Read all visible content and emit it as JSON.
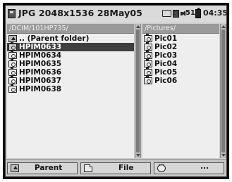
{
  "status": {
    "title": "JPG 2048x1536 28May05",
    "volume": "51",
    "time": "04:35",
    "icons": [
      "file-icon",
      "folder-icon",
      "hard-drive-icon",
      "speaker-icon",
      "battery-icon"
    ]
  },
  "left_pane": {
    "path": "/DCIM/101HP735/",
    "items": [
      {
        "label": ".. (Parent folder)",
        "icon": "parent-folder-icon"
      },
      {
        "label": "HPIM0633",
        "icon": "photo-icon",
        "selected": true
      },
      {
        "label": "HPIM0634",
        "icon": "photo-icon"
      },
      {
        "label": "HPIM0635",
        "icon": "photo-icon"
      },
      {
        "label": "HPIM0636",
        "icon": "photo-icon"
      },
      {
        "label": "HPIM0637",
        "icon": "photo-icon"
      },
      {
        "label": "HPIM0638",
        "icon": "photo-icon"
      }
    ]
  },
  "right_pane": {
    "path": "/Pictures/",
    "items": [
      {
        "label": "Pic01",
        "icon": "photo-icon"
      },
      {
        "label": "Pic02",
        "icon": "photo-icon"
      },
      {
        "label": "Pic03",
        "icon": "photo-icon"
      },
      {
        "label": "Pic04",
        "icon": "photo-icon"
      },
      {
        "label": "Pic05",
        "icon": "photo-icon"
      },
      {
        "label": "Pic06",
        "icon": "photo-icon"
      }
    ]
  },
  "softkeys": {
    "parent": "Parent",
    "file": "File",
    "more": "..."
  },
  "colors": {
    "selection": "#3f3f3f",
    "header": "#9a9a9a",
    "list_bg": "#eeeeee"
  }
}
